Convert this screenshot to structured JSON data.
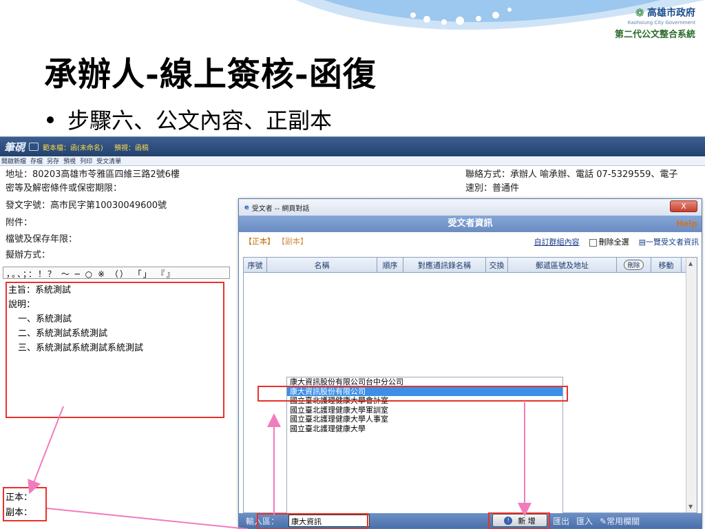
{
  "logo": {
    "name": "高雄市政府",
    "sub": "Kaohsiung City Government",
    "system": "第二代公文整合系統"
  },
  "title": "承辦人-線上簽核-函復",
  "subtitle": "步驟六、公文內容、正副本",
  "app": {
    "logo_text": "筆硯",
    "template": "範本檔：函(未命名)",
    "preview": "預視：函稿",
    "toolbar": [
      "開啟新檔",
      "存檔",
      "另存",
      "預視",
      "列印",
      "受文清單"
    ]
  },
  "doc": {
    "address": "地址：80203高雄市苓雅區四維三路2號6樓",
    "contact": "聯絡方式：承辦人 喻承辦、電話 07-5329559、電子",
    "secret": "密等及解密條件或保密期限：",
    "speed": "速別：普通件",
    "doc_no": "發文字號：高市民字第10030049600號",
    "attach": "附件：",
    "retention": "檔號及保存年限：",
    "method": "擬辦方式：",
    "punct": "，。、；：！？ ～ ─ ○ ※ （） 「」 『』",
    "content": [
      {
        "text": "主旨：系統測試",
        "indent": false
      },
      {
        "text": "說明：",
        "indent": false
      },
      {
        "text": "一、系統測試",
        "indent": true
      },
      {
        "text": "二、系統測試系統測試",
        "indent": true
      },
      {
        "text": "三、系統測試系統測試系統測試",
        "indent": true
      }
    ],
    "main_recipient": "正本：",
    "cc": "副本："
  },
  "dialog": {
    "caption": "受文者 -- 網頁對話",
    "close": "X",
    "header": "受文者資訊",
    "help": "Help",
    "tab_main": "【正本】",
    "tab_cc": "【副本】",
    "custom_group": "自訂群組內容",
    "delete_all": "刪除全選",
    "list_all": "一覽受文者資訊",
    "columns": [
      "序號",
      "名稱",
      "順序",
      "對應通訊錄名稱",
      "交換",
      "郵遞區號及地址",
      "刪除",
      "移動"
    ],
    "list": [
      "康大資訊股份有限公司台中分公司",
      "康大資訊股份有限公司",
      "國立臺北護理健康大學會計室",
      "國立臺北護理健康大學軍訓室",
      "國立臺北護理健康大學人事室",
      "國立臺北護理健康大學"
    ],
    "selected_index": 1,
    "input_label": "輸入區：",
    "input_value": "康大資訊",
    "add_button": "新 增",
    "bottom_links": [
      "匯出",
      "匯入",
      "常用欄關"
    ]
  },
  "colors": {
    "highlight_box": "#e8312a",
    "arrow": "#f27bbd",
    "selection": "#3d8fe6"
  }
}
